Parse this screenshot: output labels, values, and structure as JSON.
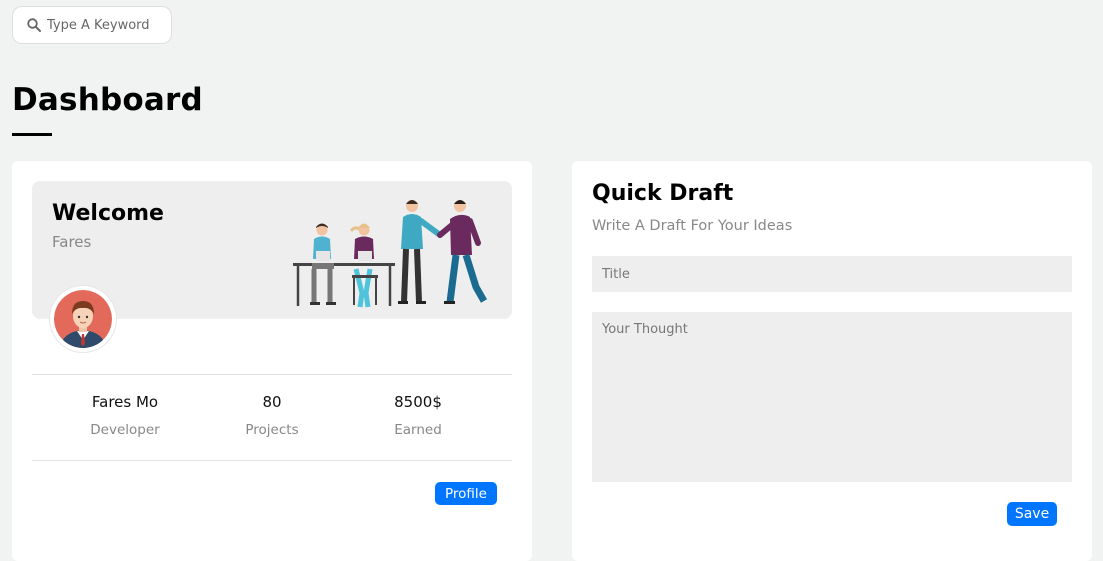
{
  "search": {
    "placeholder": "Type A Keyword",
    "icon": "search-icon"
  },
  "page": {
    "title": "Dashboard"
  },
  "welcome": {
    "title": "Welcome",
    "name": "Fares",
    "stats": [
      {
        "value": "Fares Mo",
        "label": "Developer"
      },
      {
        "value": "80",
        "label": "Projects"
      },
      {
        "value": "8500$",
        "label": "Earned"
      }
    ],
    "profile_button": "Profile"
  },
  "quick_draft": {
    "title": "Quick Draft",
    "subtitle": "Write A Draft For Your Ideas",
    "title_placeholder": "Title",
    "thought_placeholder": "Your Thought",
    "save_button": "Save"
  },
  "colors": {
    "accent": "#0075ff",
    "background": "#f1f2f2",
    "field": "#eeeeee"
  }
}
